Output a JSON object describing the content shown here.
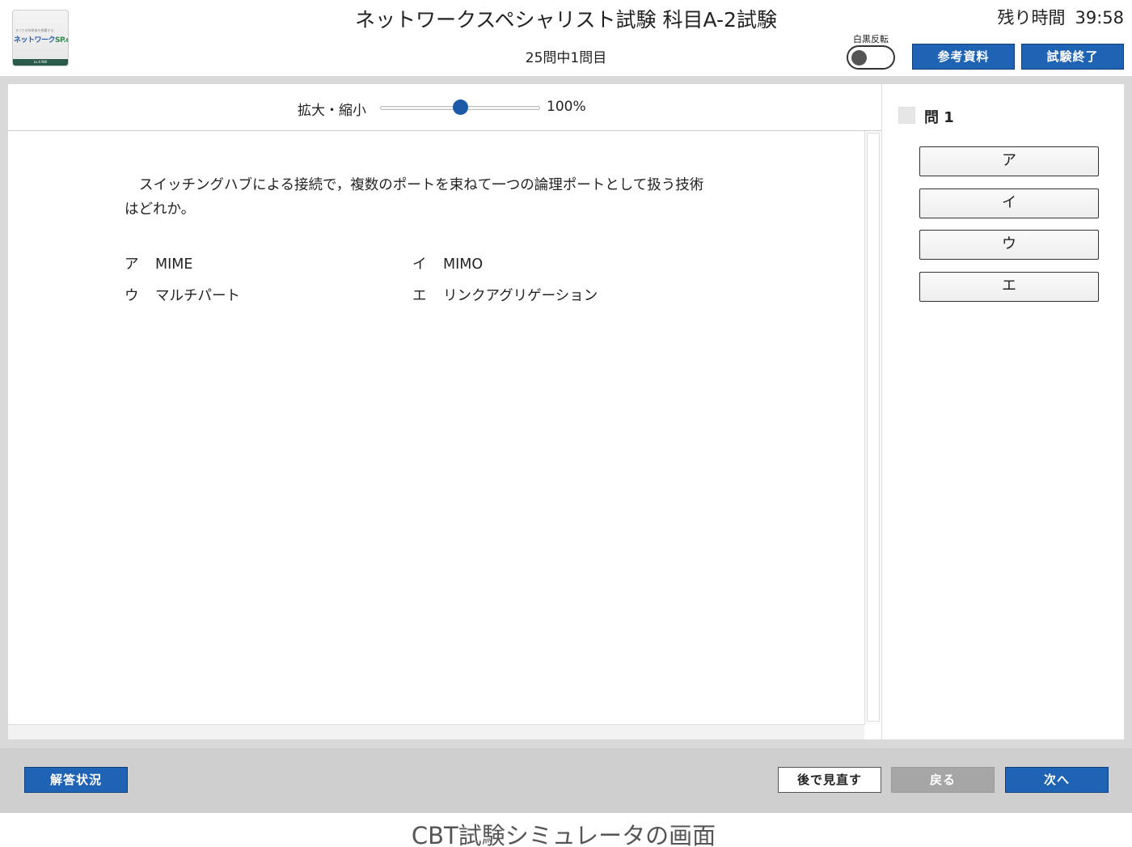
{
  "logo": {
    "tagline": "すべての技術者を網羅する",
    "brand_main": "ネットワーク",
    "brand_sp": "SP.com",
    "bar_text": "Lv.4 NW"
  },
  "header": {
    "title": "ネットワークスペシャリスト試験 科目A-2試験",
    "progress": "25問中1問目",
    "timer_label": "残り時間",
    "timer_value": "39:58",
    "invert_label": "白黒反転",
    "invert_on": false,
    "reference_button": "参考資料",
    "end_button": "試験終了"
  },
  "zoom": {
    "label": "拡大・縮小",
    "value": "100%",
    "level_fraction": 0.5
  },
  "question": {
    "text": "スイッチングハブによる接続で，複数のポートを束ねて一つの論理ポートとして扱う技術はどれか。",
    "choices": [
      {
        "key": "ア",
        "text": "MIME"
      },
      {
        "key": "イ",
        "text": "MIMO"
      },
      {
        "key": "ウ",
        "text": "マルチパート"
      },
      {
        "key": "エ",
        "text": "リンクアグリゲーション"
      }
    ]
  },
  "answer_panel": {
    "question_label": "問 1",
    "options": [
      "ア",
      "イ",
      "ウ",
      "エ"
    ]
  },
  "footer": {
    "status_button": "解答状況",
    "review_button": "後で見直す",
    "back_button": "戻る",
    "next_button": "次へ"
  },
  "caption": "CBT試験シミュレータの画面"
}
